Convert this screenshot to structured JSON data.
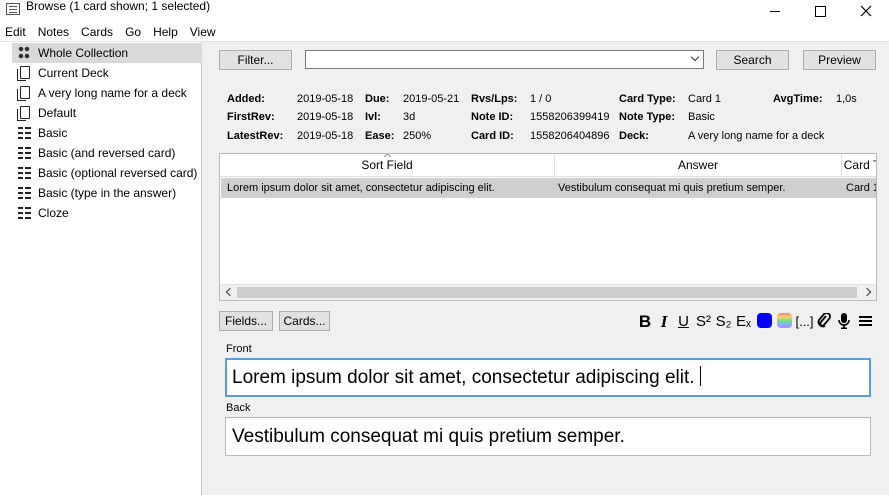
{
  "window": {
    "title": "Browse (1 card shown; 1 selected)"
  },
  "menu": [
    "Edit",
    "Notes",
    "Cards",
    "Go",
    "Help",
    "View"
  ],
  "sidebar": {
    "items": [
      {
        "label": "Whole Collection",
        "icon": "collection-icon",
        "selected": true
      },
      {
        "label": "Current Deck",
        "icon": "deck-icon"
      },
      {
        "label": "A very long name for a deck",
        "icon": "deck-icon"
      },
      {
        "label": "Default",
        "icon": "deck-icon"
      },
      {
        "label": "Basic",
        "icon": "note-type-icon"
      },
      {
        "label": "Basic (and reversed card)",
        "icon": "note-type-icon"
      },
      {
        "label": "Basic (optional reversed card)",
        "icon": "note-type-icon"
      },
      {
        "label": "Basic (type in the answer)",
        "icon": "note-type-icon"
      },
      {
        "label": "Cloze",
        "icon": "note-type-icon"
      }
    ]
  },
  "toolbar": {
    "filter_label": "Filter...",
    "search_value": "",
    "search_label": "Search",
    "preview_label": "Preview"
  },
  "card_info": {
    "added_label": "Added:",
    "added": "2019-05-18",
    "due_label": "Due:",
    "due": "2019-05-21",
    "rvs_label": "Rvs/Lps:",
    "rvs": "1 / 0",
    "card_type_label": "Card Type:",
    "card_type": "Card 1",
    "avg_time_label": "AvgTime:",
    "avg_time": "1,0s",
    "first_rev_label": "FirstRev:",
    "first_rev": "2019-05-18",
    "ivl_label": "Ivl:",
    "ivl": "3d",
    "note_id_label": "Note ID:",
    "note_id": "1558206399419",
    "note_type_label": "Note Type:",
    "note_type": "Basic",
    "latest_rev_label": "LatestRev:",
    "latest_rev": "2019-05-18",
    "ease_label": "Ease:",
    "ease": "250%",
    "card_id_label": "Card ID:",
    "card_id": "1558206404896",
    "deck_label": "Deck:",
    "deck": "A very long name for a deck"
  },
  "table": {
    "columns": [
      "Sort Field",
      "Answer",
      "Card T"
    ],
    "rows": [
      {
        "sort_field": "Lorem ipsum dolor sit amet, consectetur adipiscing elit.",
        "answer": "Vestibulum consequat mi quis pretium semper.",
        "card": "Card 1"
      }
    ]
  },
  "editor": {
    "fields_label": "Fields...",
    "cards_label": "Cards...",
    "format_buttons": [
      "B",
      "I",
      "U",
      "S²",
      "S₂",
      "Eₓ",
      "text-color-icon",
      "highlight-color-icon",
      "[...]",
      "attach-icon",
      "record-audio-icon",
      "more-icon"
    ],
    "fields": [
      {
        "name": "Front",
        "value": "Lorem ipsum dolor sit amet, consectetur adipiscing elit."
      },
      {
        "name": "Back",
        "value": "Vestibulum consequat mi quis pretium semper."
      }
    ]
  }
}
